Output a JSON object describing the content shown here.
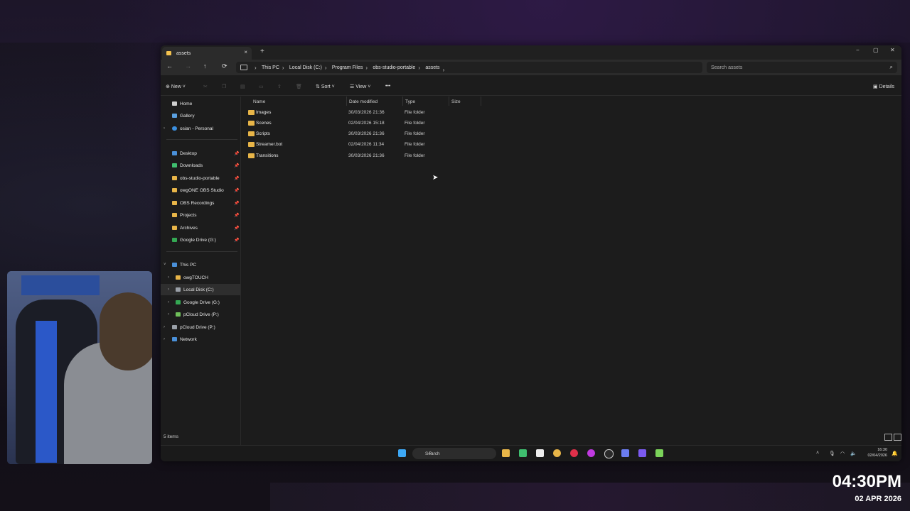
{
  "tab": {
    "title": "assets",
    "close": "×",
    "new": "+"
  },
  "window_controls": {
    "min": "−",
    "max": "▢",
    "close": "✕"
  },
  "nav": {
    "back": "←",
    "forward": "→",
    "up": "↑",
    "refresh": "⟳"
  },
  "breadcrumb": [
    "This PC",
    "Local Disk (C:)",
    "Program Files",
    "obs-studio-portable",
    "assets"
  ],
  "search": {
    "placeholder": "Search assets"
  },
  "toolbar": {
    "new": "New",
    "sort": "Sort",
    "view": "View",
    "more": "•••",
    "details": "Details"
  },
  "sidebar": {
    "quick": [
      {
        "label": "Home"
      },
      {
        "label": "Gallery"
      },
      {
        "label": "osian - Personal"
      }
    ],
    "pinned": [
      {
        "label": "Desktop"
      },
      {
        "label": "Downloads"
      },
      {
        "label": "obs-studio-portable"
      },
      {
        "label": "owgONE OBS Studio"
      },
      {
        "label": "OBS Recordings"
      },
      {
        "label": "Projects"
      },
      {
        "label": "Archives"
      },
      {
        "label": "Google Drive (G:)"
      }
    ],
    "tree": [
      {
        "label": "This PC"
      },
      {
        "label": "owgTOUCH"
      },
      {
        "label": "Local Disk (C:)"
      },
      {
        "label": "Google Drive (G:)"
      },
      {
        "label": "pCloud Drive (P:)"
      },
      {
        "label": "pCloud Drive (P:)"
      },
      {
        "label": "Network"
      }
    ]
  },
  "columns": {
    "name": "Name",
    "date": "Date modified",
    "type": "Type",
    "size": "Size"
  },
  "files": [
    {
      "name": "Images",
      "date": "30/03/2026 21:36",
      "type": "File folder"
    },
    {
      "name": "Scenes",
      "date": "02/04/2026 15:18",
      "type": "File folder"
    },
    {
      "name": "Scripts",
      "date": "30/03/2026 21:36",
      "type": "File folder"
    },
    {
      "name": "Streamer.bot",
      "date": "02/04/2026 11:34",
      "type": "File folder"
    },
    {
      "name": "Transitions",
      "date": "30/03/2026 21:36",
      "type": "File folder"
    }
  ],
  "status": {
    "count": "5 items"
  },
  "taskbar": {
    "search": "Search",
    "time": "16:30",
    "date": "02/04/2026"
  },
  "overlay": {
    "time": "04:30PM",
    "date": "02 APR 2026"
  }
}
